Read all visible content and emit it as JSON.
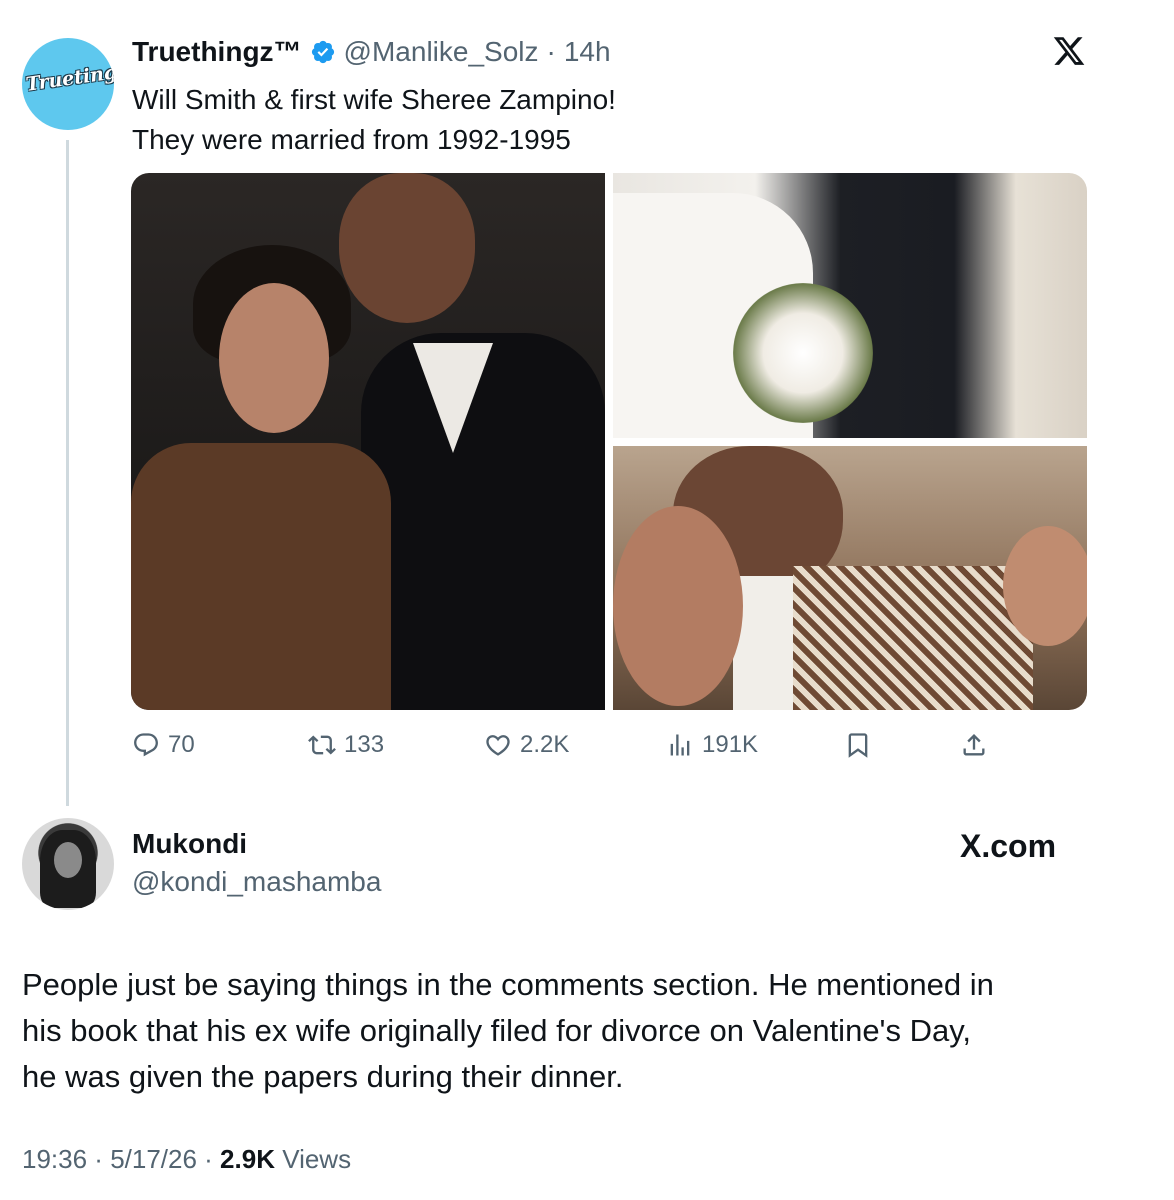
{
  "quoted_tweet": {
    "avatar_logo_text": "Truetingz",
    "display_name": "Truethingz™",
    "handle": "@Manlike_Solz",
    "separator": "·",
    "time": "14h",
    "text_lines": [
      "Will Smith & first wife Sheree Zampino!",
      "They were married from 1992-1995"
    ],
    "images": [
      {
        "alt": "photo-couple-event"
      },
      {
        "alt": "photo-wedding"
      },
      {
        "alt": "photo-family-with-baby"
      }
    ],
    "actions": {
      "replies": "70",
      "reposts": "133",
      "likes": "2.2K",
      "views": "191K"
    },
    "colors": {
      "verified_badge": "#1d9bf0",
      "avatar_bg": "#5ec8ee",
      "secondary_text": "#536471",
      "thread_line": "#cfd9de"
    }
  },
  "reply_tweet": {
    "display_name": "Mukondi",
    "handle": "@kondi_mashamba",
    "watermark": "X.com",
    "text_lines": [
      "People just be saying things in the comments section. He mentioned in",
      "his book that his ex wife originally filed for divorce on Valentine's Day,",
      "he was given the papers during their dinner."
    ],
    "meta": {
      "time": "19:36",
      "sep1": " · ",
      "date": "5/17/26",
      "sep2": " · ",
      "views_count": "2.9K",
      "views_label": " Views"
    }
  },
  "icons": {
    "close": "x-logo-icon",
    "reply": "reply-bubble-icon",
    "repost": "repost-icon",
    "like": "heart-icon",
    "views": "views-bar-icon",
    "bookmark": "bookmark-icon",
    "share": "share-icon",
    "verified": "verified-badge-icon"
  }
}
